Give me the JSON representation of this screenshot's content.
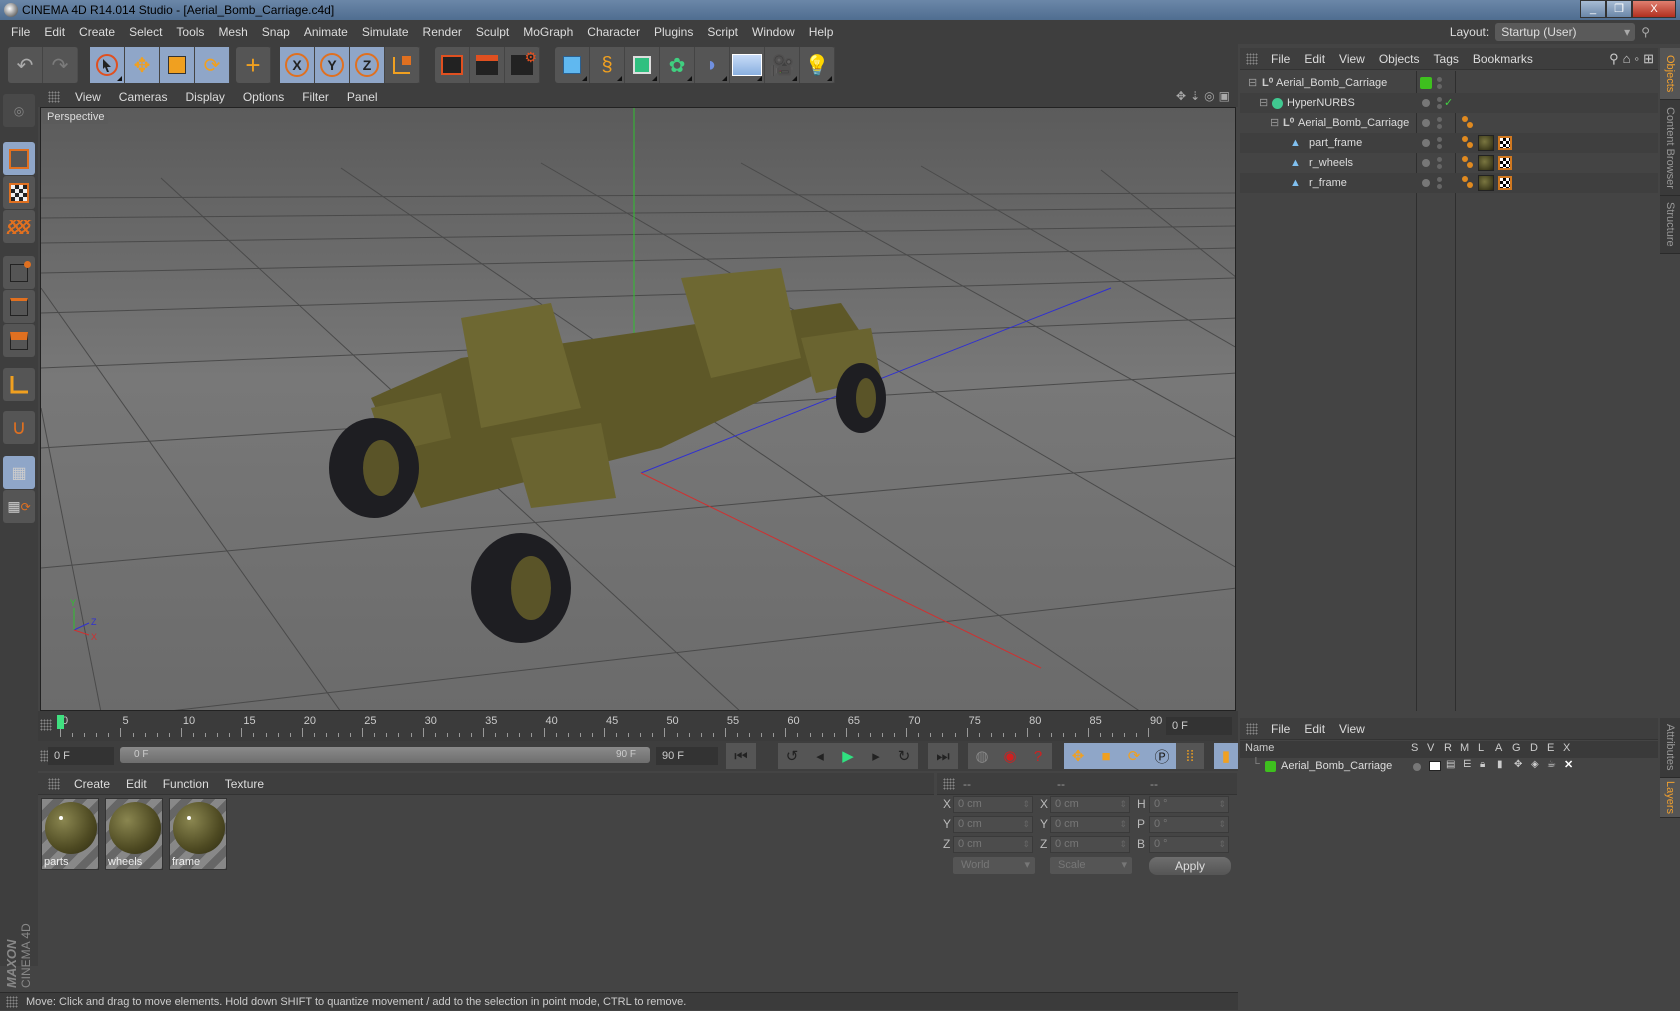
{
  "window": {
    "title": "CINEMA 4D R14.014 Studio - [Aerial_Bomb_Carriage.c4d]",
    "buttons": [
      "minimize",
      "restore",
      "close"
    ]
  },
  "menubar": [
    "File",
    "Edit",
    "Create",
    "Select",
    "Tools",
    "Mesh",
    "Snap",
    "Animate",
    "Simulate",
    "Render",
    "Sculpt",
    "MoGraph",
    "Character",
    "Plugins",
    "Script",
    "Window",
    "Help"
  ],
  "layout": {
    "label": "Layout:",
    "value": "Startup (User)"
  },
  "toolbar": {
    "groups": [
      [
        "undo-icon",
        "redo-icon"
      ],
      [
        "live-select-icon",
        "move-icon",
        "scale-icon",
        "rotate-icon"
      ],
      [
        "add-object-icon"
      ],
      [
        "x-axis-icon",
        "y-axis-icon",
        "z-axis-icon",
        "coordinate-system-icon"
      ],
      [
        "render-view-icon",
        "render-picture-viewer-icon",
        "render-settings-icon"
      ],
      [
        "cube-icon",
        "spline-pen-icon",
        "subdivision-icon",
        "array-icon",
        "deformer-icon",
        "floor-icon",
        "camera-icon",
        "light-icon"
      ]
    ]
  },
  "left_tools": [
    "make-editable-icon",
    "model-mode-icon",
    "texture-mode-icon",
    "workplane-mode-icon",
    "points-mode-icon",
    "edges-mode-icon",
    "polygons-mode-icon",
    "axis-mode-icon",
    "magnet-icon",
    "workplane-lock-icon",
    "workplane-sync-icon"
  ],
  "brand": {
    "line1": "MAXON",
    "line2": "CINEMA 4D"
  },
  "viewport": {
    "menu": [
      "View",
      "Cameras",
      "Display",
      "Options",
      "Filter",
      "Panel"
    ],
    "label": "Perspective",
    "nav_icons": [
      "pan-icon",
      "zoom-icon",
      "orbit-icon",
      "maximize-icon"
    ],
    "axis_labels": {
      "x": "X",
      "y": "Y",
      "z": "Z"
    },
    "colors": {
      "x_axis": "#d03030",
      "y_axis": "#30c030",
      "z_axis": "#3030d0",
      "model": "#6b6530",
      "tire": "#1e1e22"
    }
  },
  "timeline": {
    "ticks": [
      0,
      5,
      10,
      15,
      20,
      25,
      30,
      35,
      40,
      45,
      50,
      55,
      60,
      65,
      70,
      75,
      80,
      85,
      90
    ],
    "current_frame_marker": 0,
    "current_frame": "0 F",
    "start": "0 F",
    "range_start": "0 F",
    "range_end": "90 F",
    "end": "90 F"
  },
  "transport": [
    "go-to-start-icon",
    "previous-key-icon",
    "previous-frame-icon",
    "play-icon",
    "next-frame-icon",
    "next-key-icon",
    "go-to-end-icon",
    "record-keys-disabled-icon",
    "autokey-icon",
    "keyframe-selection-icon",
    "position-key-icon",
    "scale-key-icon",
    "rotation-key-icon",
    "parameter-key-icon",
    "point-level-icon",
    "timeline-icon"
  ],
  "materials": {
    "menu": [
      "Create",
      "Edit",
      "Function",
      "Texture"
    ],
    "items": [
      {
        "name": "parts"
      },
      {
        "name": "wheels"
      },
      {
        "name": "frame"
      }
    ]
  },
  "coordinates": {
    "headers": [
      "--",
      "--",
      "--"
    ],
    "rows": [
      {
        "l1": "X",
        "v1": "0 cm",
        "l2": "X",
        "v2": "0 cm",
        "l3": "H",
        "v3": "0 °"
      },
      {
        "l1": "Y",
        "v1": "0 cm",
        "l2": "Y",
        "v2": "0 cm",
        "l3": "P",
        "v3": "0 °"
      },
      {
        "l1": "Z",
        "v1": "0 cm",
        "l2": "Z",
        "v2": "0 cm",
        "l3": "B",
        "v3": "0 °"
      }
    ],
    "mode": "World",
    "transform": "Scale",
    "apply": "Apply"
  },
  "status": "Move: Click and drag to move elements. Hold down SHIFT to quantize movement / add to the selection in point mode, CTRL to remove.",
  "objects": {
    "menu": [
      "File",
      "Edit",
      "View",
      "Objects",
      "Tags",
      "Bookmarks"
    ],
    "tree": [
      {
        "name": "Aerial_Bomb_Carriage",
        "icon": "null-icon",
        "depth": 0,
        "layer_color": "#3ec01e"
      },
      {
        "name": "HyperNURBS",
        "icon": "hypernurbs-icon",
        "depth": 1,
        "enabled": "✓"
      },
      {
        "name": "Aerial_Bomb_Carriage",
        "icon": "null-icon",
        "depth": 2
      },
      {
        "name": "part_frame",
        "icon": "polygon-icon",
        "depth": 3
      },
      {
        "name": "r_wheels",
        "icon": "polygon-icon",
        "depth": 3
      },
      {
        "name": "r_frame",
        "icon": "polygon-icon",
        "depth": 3
      }
    ]
  },
  "right_tabs": {
    "top": [
      "Objects",
      "Content Browser",
      "Structure"
    ],
    "bottom": [
      "Attributes",
      "Layers"
    ]
  },
  "layers": {
    "menu": [
      "File",
      "Edit",
      "View"
    ],
    "columns": [
      "Name",
      "S",
      "V",
      "R",
      "M",
      "L",
      "A",
      "G",
      "D",
      "E",
      "X"
    ],
    "rows": [
      {
        "name": "Aerial_Bomb_Carriage",
        "color": "#3ec01e"
      }
    ]
  }
}
